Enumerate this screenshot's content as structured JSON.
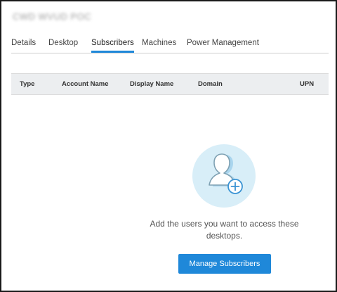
{
  "page": {
    "title": "CWD WVUD POC"
  },
  "tabs": [
    {
      "label": "Details",
      "active": false
    },
    {
      "label": "Desktop",
      "active": false
    },
    {
      "label": "Subscribers",
      "active": true
    },
    {
      "label": "Machines",
      "active": false
    },
    {
      "label": "Power Management",
      "active": false
    }
  ],
  "table": {
    "columns": [
      "Type",
      "Account Name",
      "Display Name",
      "Domain",
      "UPN"
    ]
  },
  "empty_state": {
    "icon": "add-user-icon",
    "message": "Add the users you want to access these desktops.",
    "button_label": "Manage Subscribers"
  },
  "colors": {
    "accent": "#1f88d9",
    "icon_circle": "#d8eef8",
    "header_bg": "#eceef0"
  }
}
